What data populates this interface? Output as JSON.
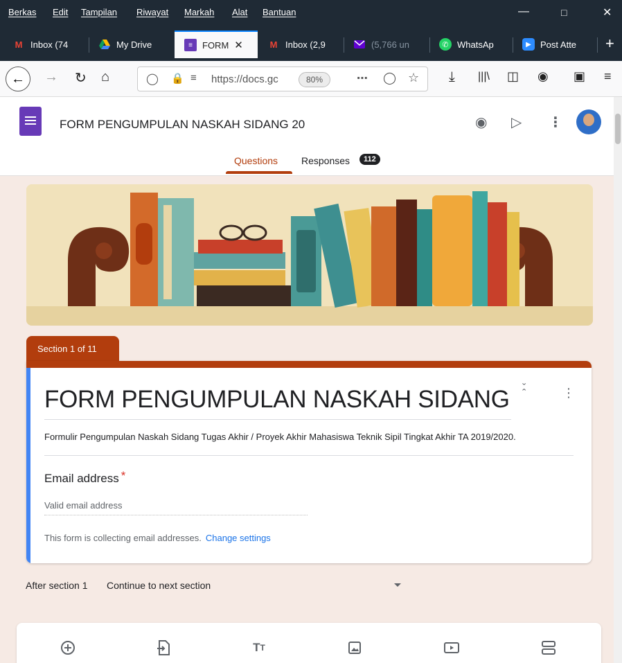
{
  "menubar": {
    "items": [
      "Berkas",
      "Edit",
      "Tampilan",
      "Riwayat",
      "Markah",
      "Alat",
      "Bantuan"
    ]
  },
  "tabs": [
    {
      "label": "Inbox (74",
      "icon": "gmail-icon",
      "color": "#ea4335"
    },
    {
      "label": "My Drive",
      "icon": "drive-icon",
      "color": "#fbbc04"
    },
    {
      "label": "FORM",
      "icon": "forms-icon",
      "color": "#673ab7",
      "active": true
    },
    {
      "label": "Inbox (2,9",
      "icon": "gmail-icon",
      "color": "#ea4335"
    },
    {
      "label": "(5,766 un",
      "icon": "yahoo-mail-icon",
      "color": "#6001d2"
    },
    {
      "label": "WhatsAp",
      "icon": "whatsapp-icon",
      "color": "#25d366"
    },
    {
      "label": "Post Atte",
      "icon": "zoom-icon",
      "color": "#2d8cff"
    }
  ],
  "navbar": {
    "url": "https://docs.gc",
    "zoom": "80%"
  },
  "form_header": {
    "title": "FORM PENGUMPULAN NASKAH SIDANG 20",
    "tab_questions": "Questions",
    "tab_responses": "Responses",
    "responses_count": "112"
  },
  "section": {
    "label": "Section 1 of 11",
    "title": "FORM PENGUMPULAN NASKAH SIDANG",
    "description": "Formulir Pengumpulan Naskah Sidang Tugas Akhir / Proyek Akhir Mahasiswa Teknik Sipil Tingkat Akhir TA 2019/2020.",
    "email_label": "Email address",
    "email_placeholder": "Valid email address",
    "collect_note": "This form is collecting email addresses.",
    "change_settings": "Change settings"
  },
  "after_section": {
    "label": "After section 1",
    "value": "Continue to next section"
  },
  "colors": {
    "accent": "#b23d0d",
    "forms_purple": "#673ab7",
    "section_bar": "#4285f4",
    "background": "#f6eae4"
  }
}
